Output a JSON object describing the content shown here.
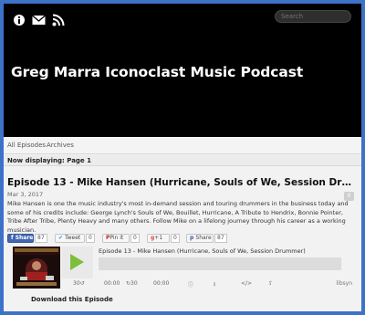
{
  "header": {
    "icons": [
      "info-icon",
      "mail-icon",
      "rss-icon"
    ],
    "search_placeholder": "Search",
    "podcast_title": "Greg Marra Iconoclast Music Podcast",
    "background": "#000000"
  },
  "nav": {
    "items": [
      "All Episodes",
      "Archives"
    ]
  },
  "displaying": "Now displaying: Page 1",
  "episode": {
    "title": "Episode 13 - Mike Hansen (Hurricane, Souls of We, Session Drumm...",
    "date": "Mar 3, 2017",
    "comment_count": "0",
    "description": "Mike Hansen is one the music industry's most in-demand session and touring drummers in the business today and some of his credits include: George Lynch's Souls of We, Bouillet, Hurricane, A Tribute to Hendrix, Bonnie Pointer, Tribe After Tribe, Plenty Heavy and many others. Follow Mike on a lifelong journey through his career as a working musician."
  },
  "share": {
    "facebook": {
      "label": "Share",
      "count": "87"
    },
    "twitter": {
      "label": "Tweet",
      "count": "0"
    },
    "pinterest": {
      "label": "Pin it",
      "count": "0"
    },
    "gplus": {
      "label": "+1",
      "count": "0"
    },
    "plain": {
      "label": "Share",
      "count": "87"
    }
  },
  "player": {
    "title": "Episode 13 - Mike Hansen (Hurricane, Souls of We, Session Drummer)",
    "back_label": "30",
    "forward_label": "30",
    "time_current": "00:00",
    "time_total": "00:00",
    "brand": "libsyn",
    "accent": "#7cbf3a"
  },
  "download_label": "Download this Episode",
  "frame_color": "#3d72c9"
}
